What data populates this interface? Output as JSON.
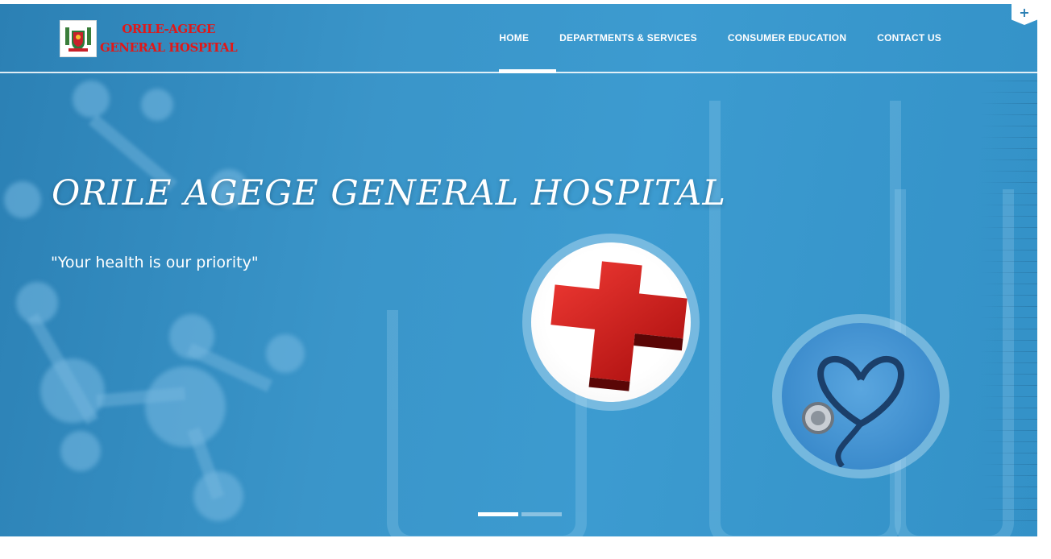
{
  "logo": {
    "line1": "ORILE-AGEGE",
    "line2": "GENERAL HOSPITAL"
  },
  "nav": {
    "items": [
      {
        "label": "HOME",
        "active": true
      },
      {
        "label": "DEPARTMENTS & SERVICES",
        "active": false
      },
      {
        "label": "CONSUMER EDUCATION",
        "active": false
      },
      {
        "label": "CONTACT US",
        "active": false
      }
    ]
  },
  "corner_tab": {
    "icon": "plus-icon",
    "symbol": "+"
  },
  "hero": {
    "title": "ORILE AGEGE GENERAL HOSPITAL",
    "subtitle": "\"Your health is our priority\""
  },
  "slider": {
    "total": 2,
    "active_index": 0
  },
  "colors": {
    "brand_blue": "#2b80b4",
    "logo_red": "#e11818",
    "white": "#ffffff"
  }
}
